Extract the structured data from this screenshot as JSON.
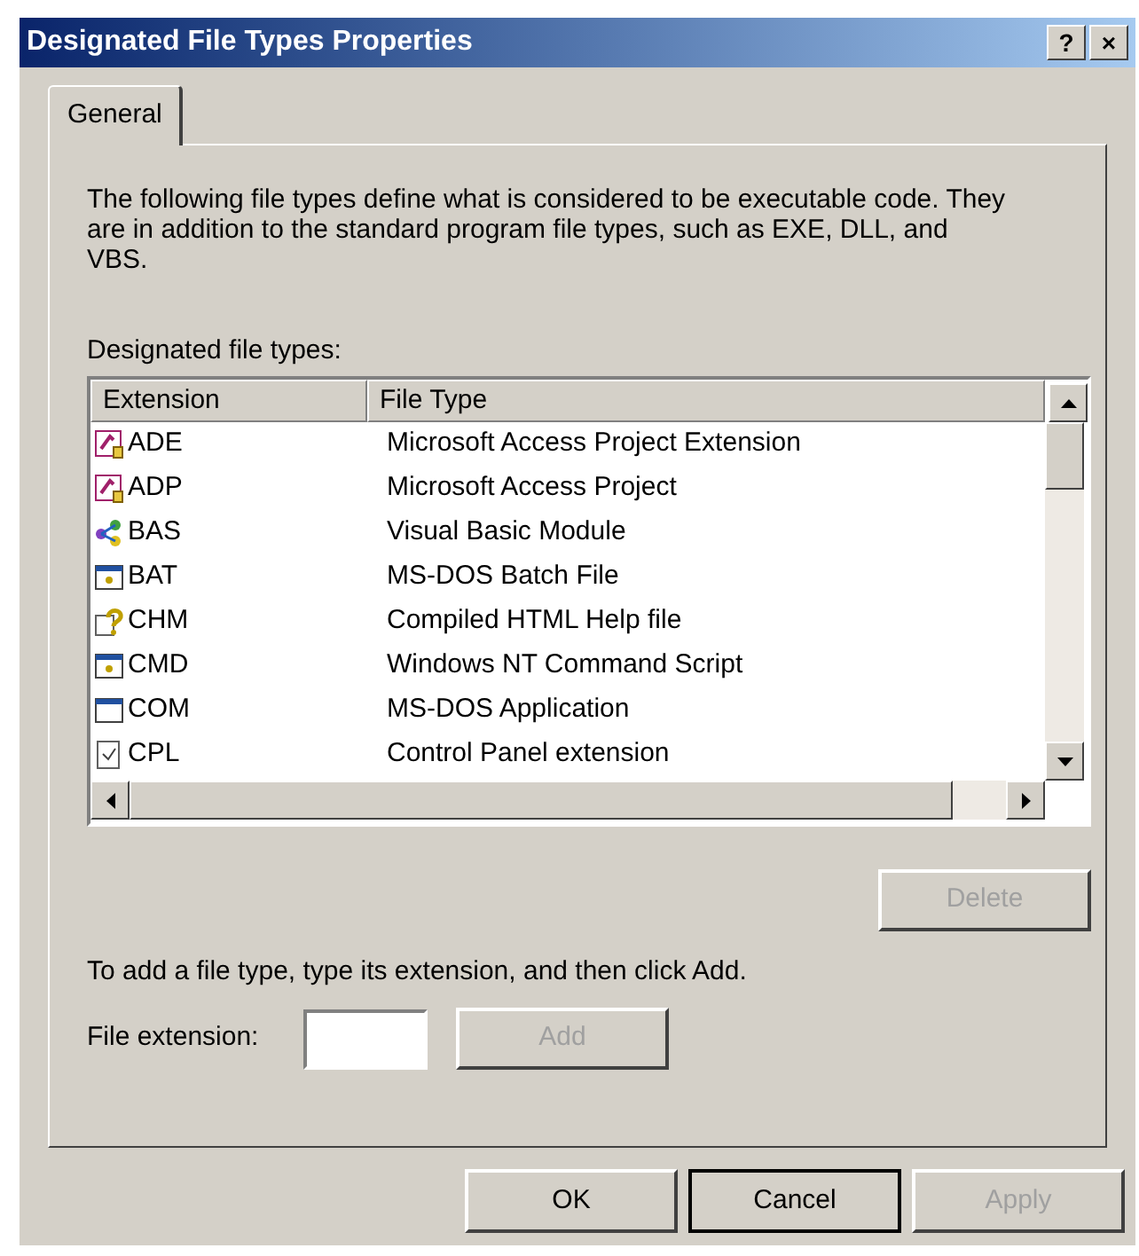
{
  "window": {
    "title": "Designated File Types Properties",
    "title_buttons": [
      "?",
      "×"
    ]
  },
  "tabs": [
    {
      "label": "General",
      "selected": true
    }
  ],
  "description": "The following file types define what is considered to be executable code. They are in addition to the standard program file types, such as EXE, DLL, and VBS.",
  "list_label": "Designated file types:",
  "table": {
    "columns": [
      "Extension",
      "File Type"
    ],
    "rows": [
      {
        "kind": "access",
        "extension": "ADE",
        "file_type": "Microsoft Access Project Extension"
      },
      {
        "kind": "access",
        "extension": "ADP",
        "file_type": "Microsoft Access Project"
      },
      {
        "kind": "module",
        "extension": "BAS",
        "file_type": "Visual Basic Module"
      },
      {
        "kind": "console",
        "extension": "BAT",
        "file_type": "MS-DOS Batch File"
      },
      {
        "kind": "help",
        "extension": "CHM",
        "file_type": "Compiled HTML Help file"
      },
      {
        "kind": "console",
        "extension": "CMD",
        "file_type": "Windows NT Command Script"
      },
      {
        "kind": "window",
        "extension": "COM",
        "file_type": "MS-DOS Application"
      },
      {
        "kind": "control",
        "extension": "CPL",
        "file_type": "Control Panel extension"
      }
    ]
  },
  "delete_button": {
    "label": "Delete",
    "disabled": true
  },
  "add_hint": "To add a file type, type its extension, and then click Add.",
  "file_extension": {
    "label": "File extension:"
  },
  "add_button": {
    "label": "Add",
    "disabled": true
  },
  "buttons": [
    {
      "label": "OK",
      "disabled": false,
      "default": false
    },
    {
      "label": "Cancel",
      "disabled": false,
      "default": true
    },
    {
      "label": "Apply",
      "disabled": true,
      "default": false
    }
  ]
}
